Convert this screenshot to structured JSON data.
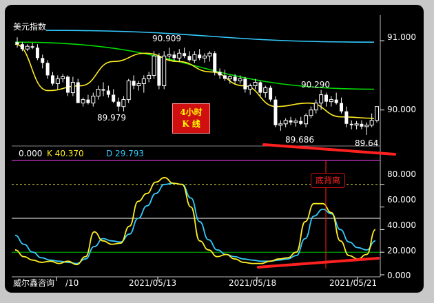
{
  "upper_panel": {
    "title": "美元指数",
    "y_ticks": [
      "91.000",
      "90.000"
    ],
    "annotations": [
      "90.909",
      "89.979",
      "90.290",
      "89.686",
      "89.64"
    ],
    "label_box": {
      "line1": "4小时",
      "line2": "K   线"
    }
  },
  "lower_panel": {
    "indicator": {
      "value0": "0.000",
      "k_label": "K 40.370",
      "d_label": "D 29.793"
    },
    "y_ticks": [
      "80.000",
      "60.000",
      "40.000",
      "20.000",
      "0.000"
    ],
    "badge": "底背离"
  },
  "x_axis": {
    "labels": [
      "/10",
      "2021/05/13",
      "2021/05/18",
      "2021/05/21"
    ]
  },
  "footer": {
    "source": "威尔鑫咨询"
  },
  "colors": {
    "up": "#ffffff",
    "down": "#ffffff",
    "ma_cyan": "#33ccff",
    "ma_green": "#00dd00",
    "ma_yellow": "#ffee22",
    "k_line": "#ffee22",
    "d_line": "#33ccff",
    "trend": "#ff2020",
    "magenta": "#ff44ff",
    "grid": "#ffffff"
  },
  "chart_data": [
    {
      "type": "candlestick",
      "title": "美元指数",
      "y_range": [
        89.45,
        91.3
      ],
      "ohlc": [
        [
          90.98,
          91.05,
          90.9,
          90.95
        ],
        [
          90.95,
          90.98,
          90.85,
          90.88
        ],
        [
          90.88,
          90.95,
          90.85,
          90.92
        ],
        [
          90.92,
          90.97,
          90.88,
          90.9
        ],
        [
          90.9,
          90.95,
          90.72,
          90.75
        ],
        [
          90.75,
          90.8,
          90.6,
          90.68
        ],
        [
          90.68,
          90.72,
          90.45,
          90.5
        ],
        [
          90.5,
          90.55,
          90.35,
          90.38
        ],
        [
          90.38,
          90.5,
          90.3,
          90.45
        ],
        [
          90.45,
          90.52,
          90.4,
          90.48
        ],
        [
          90.48,
          90.5,
          90.2,
          90.25
        ],
        [
          90.25,
          90.48,
          90.2,
          90.4
        ],
        [
          90.4,
          90.45,
          90.15,
          90.1
        ],
        [
          90.1,
          90.18,
          90.05,
          90.15
        ],
        [
          90.15,
          90.22,
          90.08,
          90.1
        ],
        [
          90.1,
          90.25,
          90.05,
          90.2
        ],
        [
          90.2,
          90.35,
          90.15,
          90.3
        ],
        [
          90.3,
          90.4,
          90.2,
          90.28
        ],
        [
          90.28,
          90.35,
          90.18,
          90.22
        ],
        [
          90.22,
          90.3,
          90.1,
          90.12
        ],
        [
          90.12,
          90.18,
          89.98,
          90.05
        ],
        [
          90.05,
          90.2,
          89.98,
          90.15
        ],
        [
          90.15,
          90.45,
          90.1,
          90.42
        ],
        [
          90.42,
          90.5,
          90.3,
          90.35
        ],
        [
          90.35,
          90.42,
          90.28,
          90.38
        ],
        [
          90.38,
          90.5,
          90.25,
          90.45
        ],
        [
          90.45,
          90.55,
          90.4,
          90.5
        ],
        [
          90.5,
          90.85,
          90.45,
          90.78
        ],
        [
          90.78,
          90.82,
          90.3,
          90.35
        ],
        [
          90.35,
          90.85,
          90.3,
          90.78
        ],
        [
          90.78,
          90.9,
          90.72,
          90.8
        ],
        [
          90.8,
          90.85,
          90.7,
          90.75
        ],
        [
          90.75,
          90.88,
          90.7,
          90.82
        ],
        [
          90.82,
          90.9,
          90.75,
          90.78
        ],
        [
          90.78,
          90.85,
          90.7,
          90.72
        ],
        [
          90.72,
          90.85,
          90.68,
          90.8
        ],
        [
          90.8,
          90.88,
          90.72,
          90.75
        ],
        [
          90.75,
          90.82,
          90.68,
          90.78
        ],
        [
          90.78,
          90.85,
          90.7,
          90.82
        ],
        [
          90.82,
          90.85,
          90.5,
          90.55
        ],
        [
          90.55,
          90.6,
          90.45,
          90.5
        ],
        [
          90.5,
          90.58,
          90.42,
          90.45
        ],
        [
          90.45,
          90.5,
          90.38,
          90.48
        ],
        [
          90.48,
          90.52,
          90.38,
          90.42
        ],
        [
          90.42,
          90.5,
          90.38,
          90.45
        ],
        [
          90.45,
          90.48,
          90.25,
          90.3
        ],
        [
          90.3,
          90.38,
          90.22,
          90.35
        ],
        [
          90.35,
          90.45,
          90.3,
          90.4
        ],
        [
          90.4,
          90.42,
          90.2,
          90.25
        ],
        [
          90.25,
          90.35,
          90.18,
          90.32
        ],
        [
          90.32,
          90.35,
          90.12,
          90.15
        ],
        [
          90.15,
          90.2,
          89.75,
          89.78
        ],
        [
          89.78,
          89.85,
          89.7,
          89.8
        ],
        [
          89.8,
          89.88,
          89.75,
          89.85
        ],
        [
          89.85,
          89.9,
          89.78,
          89.82
        ],
        [
          89.82,
          89.88,
          89.76,
          89.84
        ],
        [
          89.84,
          89.9,
          89.78,
          89.8
        ],
        [
          89.8,
          89.95,
          89.75,
          89.92
        ],
        [
          89.92,
          90.05,
          89.88,
          90.0
        ],
        [
          90.0,
          90.15,
          89.95,
          90.1
        ],
        [
          90.1,
          90.29,
          90.0,
          90.22
        ],
        [
          90.22,
          90.25,
          90.05,
          90.12
        ],
        [
          90.12,
          90.2,
          90.05,
          90.15
        ],
        [
          90.15,
          90.25,
          90.08,
          90.1
        ],
        [
          90.1,
          90.18,
          89.95,
          89.98
        ],
        [
          89.98,
          90.05,
          89.75,
          89.8
        ],
        [
          89.8,
          89.85,
          89.72,
          89.78
        ],
        [
          89.78,
          89.84,
          89.72,
          89.8
        ],
        [
          89.8,
          89.85,
          89.72,
          89.76
        ],
        [
          89.76,
          89.82,
          89.64,
          89.78
        ],
        [
          89.78,
          89.95,
          89.75,
          89.85
        ],
        [
          89.85,
          90.05,
          89.82,
          90.05
        ]
      ],
      "ma_cyan": [
        91.15,
        90.98
      ],
      "ma_green": [
        90.98,
        90.3
      ],
      "ma_yellow": [
        90.95,
        90.28,
        90.35,
        90.7,
        90.82,
        90.7,
        90.55,
        90.35,
        90.05,
        90.1,
        89.9,
        89.88
      ]
    },
    {
      "type": "line",
      "y_range": [
        0,
        100
      ],
      "series": [
        {
          "name": "K",
          "values": [
            22,
            16,
            13,
            11,
            12,
            10,
            12,
            9,
            16,
            38,
            30,
            27,
            28,
            43,
            65,
            72,
            82,
            86,
            81,
            80,
            60,
            30,
            22,
            16,
            18,
            14,
            11,
            10,
            10,
            12,
            14,
            15,
            20,
            47,
            63,
            63,
            55,
            30,
            17,
            14,
            18,
            40
          ]
        },
        {
          "name": "D",
          "values": [
            35,
            27,
            20,
            15,
            13,
            12,
            11,
            10,
            14,
            25,
            32,
            30,
            29,
            36,
            50,
            61,
            72,
            80,
            81,
            80,
            68,
            47,
            31,
            22,
            18,
            16,
            14,
            13,
            12,
            12,
            13,
            14,
            17,
            32,
            52,
            58,
            54,
            40,
            29,
            24,
            22,
            30
          ]
        }
      ],
      "ref_lines": [
        80,
        50,
        20
      ]
    }
  ]
}
